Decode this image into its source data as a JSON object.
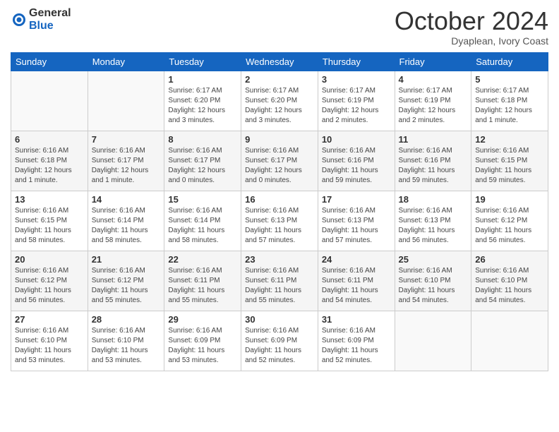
{
  "header": {
    "logo_general": "General",
    "logo_blue": "Blue",
    "month": "October 2024",
    "location": "Dyaplean, Ivory Coast"
  },
  "days_of_week": [
    "Sunday",
    "Monday",
    "Tuesday",
    "Wednesday",
    "Thursday",
    "Friday",
    "Saturday"
  ],
  "weeks": [
    [
      {
        "day": "",
        "sunrise": "",
        "sunset": "",
        "daylight": ""
      },
      {
        "day": "",
        "sunrise": "",
        "sunset": "",
        "daylight": ""
      },
      {
        "day": "1",
        "sunrise": "Sunrise: 6:17 AM",
        "sunset": "Sunset: 6:20 PM",
        "daylight": "Daylight: 12 hours and 3 minutes."
      },
      {
        "day": "2",
        "sunrise": "Sunrise: 6:17 AM",
        "sunset": "Sunset: 6:20 PM",
        "daylight": "Daylight: 12 hours and 3 minutes."
      },
      {
        "day": "3",
        "sunrise": "Sunrise: 6:17 AM",
        "sunset": "Sunset: 6:19 PM",
        "daylight": "Daylight: 12 hours and 2 minutes."
      },
      {
        "day": "4",
        "sunrise": "Sunrise: 6:17 AM",
        "sunset": "Sunset: 6:19 PM",
        "daylight": "Daylight: 12 hours and 2 minutes."
      },
      {
        "day": "5",
        "sunrise": "Sunrise: 6:17 AM",
        "sunset": "Sunset: 6:18 PM",
        "daylight": "Daylight: 12 hours and 1 minute."
      }
    ],
    [
      {
        "day": "6",
        "sunrise": "Sunrise: 6:16 AM",
        "sunset": "Sunset: 6:18 PM",
        "daylight": "Daylight: 12 hours and 1 minute."
      },
      {
        "day": "7",
        "sunrise": "Sunrise: 6:16 AM",
        "sunset": "Sunset: 6:17 PM",
        "daylight": "Daylight: 12 hours and 1 minute."
      },
      {
        "day": "8",
        "sunrise": "Sunrise: 6:16 AM",
        "sunset": "Sunset: 6:17 PM",
        "daylight": "Daylight: 12 hours and 0 minutes."
      },
      {
        "day": "9",
        "sunrise": "Sunrise: 6:16 AM",
        "sunset": "Sunset: 6:17 PM",
        "daylight": "Daylight: 12 hours and 0 minutes."
      },
      {
        "day": "10",
        "sunrise": "Sunrise: 6:16 AM",
        "sunset": "Sunset: 6:16 PM",
        "daylight": "Daylight: 11 hours and 59 minutes."
      },
      {
        "day": "11",
        "sunrise": "Sunrise: 6:16 AM",
        "sunset": "Sunset: 6:16 PM",
        "daylight": "Daylight: 11 hours and 59 minutes."
      },
      {
        "day": "12",
        "sunrise": "Sunrise: 6:16 AM",
        "sunset": "Sunset: 6:15 PM",
        "daylight": "Daylight: 11 hours and 59 minutes."
      }
    ],
    [
      {
        "day": "13",
        "sunrise": "Sunrise: 6:16 AM",
        "sunset": "Sunset: 6:15 PM",
        "daylight": "Daylight: 11 hours and 58 minutes."
      },
      {
        "day": "14",
        "sunrise": "Sunrise: 6:16 AM",
        "sunset": "Sunset: 6:14 PM",
        "daylight": "Daylight: 11 hours and 58 minutes."
      },
      {
        "day": "15",
        "sunrise": "Sunrise: 6:16 AM",
        "sunset": "Sunset: 6:14 PM",
        "daylight": "Daylight: 11 hours and 58 minutes."
      },
      {
        "day": "16",
        "sunrise": "Sunrise: 6:16 AM",
        "sunset": "Sunset: 6:13 PM",
        "daylight": "Daylight: 11 hours and 57 minutes."
      },
      {
        "day": "17",
        "sunrise": "Sunrise: 6:16 AM",
        "sunset": "Sunset: 6:13 PM",
        "daylight": "Daylight: 11 hours and 57 minutes."
      },
      {
        "day": "18",
        "sunrise": "Sunrise: 6:16 AM",
        "sunset": "Sunset: 6:13 PM",
        "daylight": "Daylight: 11 hours and 56 minutes."
      },
      {
        "day": "19",
        "sunrise": "Sunrise: 6:16 AM",
        "sunset": "Sunset: 6:12 PM",
        "daylight": "Daylight: 11 hours and 56 minutes."
      }
    ],
    [
      {
        "day": "20",
        "sunrise": "Sunrise: 6:16 AM",
        "sunset": "Sunset: 6:12 PM",
        "daylight": "Daylight: 11 hours and 56 minutes."
      },
      {
        "day": "21",
        "sunrise": "Sunrise: 6:16 AM",
        "sunset": "Sunset: 6:12 PM",
        "daylight": "Daylight: 11 hours and 55 minutes."
      },
      {
        "day": "22",
        "sunrise": "Sunrise: 6:16 AM",
        "sunset": "Sunset: 6:11 PM",
        "daylight": "Daylight: 11 hours and 55 minutes."
      },
      {
        "day": "23",
        "sunrise": "Sunrise: 6:16 AM",
        "sunset": "Sunset: 6:11 PM",
        "daylight": "Daylight: 11 hours and 55 minutes."
      },
      {
        "day": "24",
        "sunrise": "Sunrise: 6:16 AM",
        "sunset": "Sunset: 6:11 PM",
        "daylight": "Daylight: 11 hours and 54 minutes."
      },
      {
        "day": "25",
        "sunrise": "Sunrise: 6:16 AM",
        "sunset": "Sunset: 6:10 PM",
        "daylight": "Daylight: 11 hours and 54 minutes."
      },
      {
        "day": "26",
        "sunrise": "Sunrise: 6:16 AM",
        "sunset": "Sunset: 6:10 PM",
        "daylight": "Daylight: 11 hours and 54 minutes."
      }
    ],
    [
      {
        "day": "27",
        "sunrise": "Sunrise: 6:16 AM",
        "sunset": "Sunset: 6:10 PM",
        "daylight": "Daylight: 11 hours and 53 minutes."
      },
      {
        "day": "28",
        "sunrise": "Sunrise: 6:16 AM",
        "sunset": "Sunset: 6:10 PM",
        "daylight": "Daylight: 11 hours and 53 minutes."
      },
      {
        "day": "29",
        "sunrise": "Sunrise: 6:16 AM",
        "sunset": "Sunset: 6:09 PM",
        "daylight": "Daylight: 11 hours and 53 minutes."
      },
      {
        "day": "30",
        "sunrise": "Sunrise: 6:16 AM",
        "sunset": "Sunset: 6:09 PM",
        "daylight": "Daylight: 11 hours and 52 minutes."
      },
      {
        "day": "31",
        "sunrise": "Sunrise: 6:16 AM",
        "sunset": "Sunset: 6:09 PM",
        "daylight": "Daylight: 11 hours and 52 minutes."
      },
      {
        "day": "",
        "sunrise": "",
        "sunset": "",
        "daylight": ""
      },
      {
        "day": "",
        "sunrise": "",
        "sunset": "",
        "daylight": ""
      }
    ]
  ]
}
